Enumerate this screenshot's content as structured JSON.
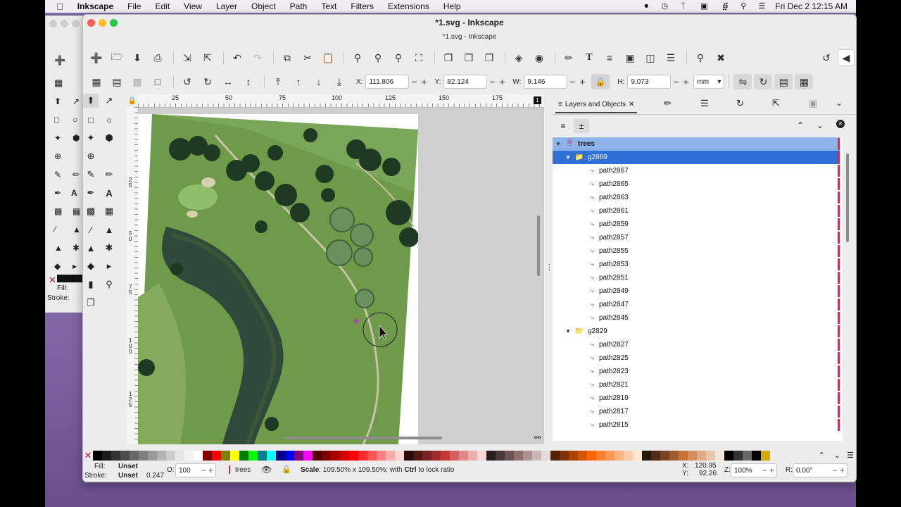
{
  "menubar": {
    "app": "Inkscape",
    "items": [
      "File",
      "Edit",
      "View",
      "Layer",
      "Object",
      "Path",
      "Text",
      "Filters",
      "Extensions",
      "Help"
    ],
    "clock": "Fri Dec 2  12:15 AM"
  },
  "window": {
    "title": "*1.svg - Inkscape",
    "subtitle": "*1.svg - Inkscape"
  },
  "controls": {
    "x_label": "X:",
    "x_value": "111.806",
    "y_label": "Y:",
    "y_value": "82.124",
    "w_label": "W:",
    "w_value": "9.146",
    "h_label": "H:",
    "h_value": "9.073",
    "unit": "mm"
  },
  "ruler": {
    "top_ticks": [
      "25",
      "50",
      "75",
      "100",
      "125",
      "150",
      "175"
    ],
    "left_ticks": [
      "25",
      "50",
      "75",
      "100",
      "125"
    ]
  },
  "panel": {
    "tab_label": "Layers and Objects",
    "rows": [
      {
        "label": "trees",
        "depth": 0,
        "kind": "layer",
        "expanded": true
      },
      {
        "label": "g2869",
        "depth": 1,
        "kind": "group",
        "expanded": true,
        "selected": true
      },
      {
        "label": "path2867",
        "depth": 2,
        "kind": "path"
      },
      {
        "label": "path2865",
        "depth": 2,
        "kind": "path"
      },
      {
        "label": "path2863",
        "depth": 2,
        "kind": "path"
      },
      {
        "label": "path2861",
        "depth": 2,
        "kind": "path"
      },
      {
        "label": "path2859",
        "depth": 2,
        "kind": "path"
      },
      {
        "label": "path2857",
        "depth": 2,
        "kind": "path"
      },
      {
        "label": "path2855",
        "depth": 2,
        "kind": "path"
      },
      {
        "label": "path2853",
        "depth": 2,
        "kind": "path"
      },
      {
        "label": "path2851",
        "depth": 2,
        "kind": "path"
      },
      {
        "label": "path2849",
        "depth": 2,
        "kind": "path"
      },
      {
        "label": "path2847",
        "depth": 2,
        "kind": "path"
      },
      {
        "label": "path2845",
        "depth": 2,
        "kind": "path"
      },
      {
        "label": "g2829",
        "depth": 1,
        "kind": "group",
        "expanded": true
      },
      {
        "label": "path2827",
        "depth": 2,
        "kind": "path"
      },
      {
        "label": "path2825",
        "depth": 2,
        "kind": "path"
      },
      {
        "label": "path2823",
        "depth": 2,
        "kind": "path"
      },
      {
        "label": "path2821",
        "depth": 2,
        "kind": "path"
      },
      {
        "label": "path2819",
        "depth": 2,
        "kind": "path"
      },
      {
        "label": "path2817",
        "depth": 2,
        "kind": "path"
      },
      {
        "label": "path2815",
        "depth": 2,
        "kind": "path"
      }
    ]
  },
  "status": {
    "fill_label": "Fill:",
    "fill_value": "Unset",
    "stroke_label": "Stroke:",
    "stroke_value": "Unset",
    "stroke_width": "0.247",
    "opacity_label": "O:",
    "opacity_value": "100",
    "layer": "trees",
    "message_bold": "Scale",
    "message": ": 109.50% x 109.50%; with ",
    "message_key": "Ctrl",
    "message_tail": " to lock ratio",
    "cursor_x_label": "X:",
    "cursor_x": "120.95",
    "cursor_y_label": "Y:",
    "cursor_y": "92.26",
    "zoom_label": "Z:",
    "zoom": "100%",
    "rotation_label": "R:",
    "rotation": "0.00°"
  },
  "bgwin": {
    "fill_label": "Fill:",
    "stroke_label": "Stroke:"
  },
  "palette": [
    "#000000",
    "#1a1a1a",
    "#333333",
    "#4d4d4d",
    "#666666",
    "#808080",
    "#999999",
    "#b3b3b3",
    "#cccccc",
    "#e6e6e6",
    "#f2f2f2",
    "#ffffff",
    "#800000",
    "#ff0000",
    "#808000",
    "#ffff00",
    "#008000",
    "#00ff00",
    "#008080",
    "#00ffff",
    "#000080",
    "#0000ff",
    "#800080",
    "#ff00ff",
    "#550000",
    "#800000",
    "#aa0000",
    "#d40000",
    "#ff0000",
    "#ff2a2a",
    "#ff5555",
    "#ff8080",
    "#ffaaaa",
    "#ffd5d5",
    "#280b0b",
    "#501616",
    "#782121",
    "#a02c2c",
    "#c83737",
    "#d35f5f",
    "#de8787",
    "#e9afaf",
    "#f4d7d7",
    "#241c1c",
    "#483737",
    "#6c5353",
    "#916f6f",
    "#ac9393",
    "#c8b7b7",
    "#e3dbdb",
    "#552200",
    "#803300",
    "#aa4400",
    "#d45500",
    "#ff6600",
    "#ff7f2a",
    "#ff9955",
    "#ffb380",
    "#ffccaa",
    "#ffe6d5",
    "#28170b",
    "#502d16",
    "#784421",
    "#a05a2c",
    "#c87137",
    "#d38d5f",
    "#deaa87",
    "#e9c6af",
    "#f4e3d7",
    "#000000",
    "#333333",
    "#666666",
    "#000000",
    "#d4aa00"
  ]
}
